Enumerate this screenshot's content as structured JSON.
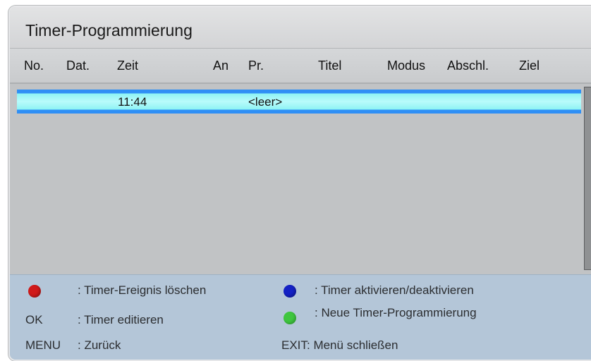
{
  "window": {
    "title": "Timer-Programmierung"
  },
  "table": {
    "columns": [
      "No.",
      "Dat.",
      "Zeit",
      "An",
      "Pr.",
      "Titel",
      "Modus",
      "Abschl.",
      "Ziel"
    ],
    "rows": [
      {
        "no": "",
        "date": "",
        "time": "11:44",
        "an": "",
        "channel": "<leer>",
        "title": "",
        "mode": "",
        "end": "",
        "target": ""
      }
    ]
  },
  "footer": {
    "red_key_label": ": Timer-Ereignis löschen",
    "ok_key": "OK",
    "ok_label": ": Timer editieren",
    "menu_key": "MENU",
    "menu_label": ": Zurück",
    "blue_key_label": ": Timer aktivieren/deaktivieren",
    "green_key_label": ": Neue Timer-Programmierung",
    "exit_key": "EXIT",
    "exit_label": ": Menü schließen"
  },
  "colors": {
    "red_key": "#d01a1a",
    "blue_key": "#1421c4",
    "green_key": "#3fc63f",
    "selection": "#2f8ff5",
    "selection_highlight": "#b9fbfb"
  },
  "icons": [
    "red-key-icon",
    "blue-key-icon",
    "green-key-icon"
  ]
}
